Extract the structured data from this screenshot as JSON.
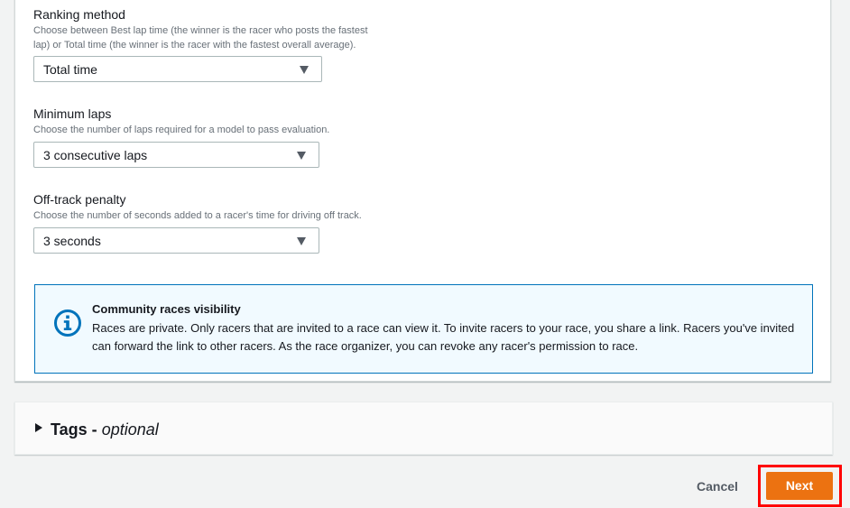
{
  "ranking": {
    "label": "Ranking method",
    "description": "Choose between Best lap time (the winner is the racer who posts the fastest lap) or Total time (the winner is the racer with the fastest overall average).",
    "desc_line1": "Choose between Best lap time (the winner is the racer who posts the fastest",
    "desc_line2": "lap) or Total time (the winner is the racer with the fastest overall average).",
    "selected": "Total time"
  },
  "min_laps": {
    "label": "Minimum laps",
    "description": "Choose the number of laps required for a model to pass evaluation.",
    "selected": "3 consecutive laps"
  },
  "penalty": {
    "label": "Off-track penalty",
    "description": "Choose the number of seconds added to a racer's time for driving off track.",
    "selected": "3 seconds"
  },
  "info": {
    "icon": "info-icon",
    "title": "Community races visibility",
    "text": "Races are private. Only racers that are invited to a race can view it. To invite racers to your race, you share a link. Racers you've invited can forward the link to other racers. As the race organizer, you can revoke any racer's permission to race."
  },
  "tags": {
    "title": "Tags -",
    "optional": "optional"
  },
  "actions": {
    "cancel": "Cancel",
    "next": "Next"
  },
  "colors": {
    "primary_button": "#ec7211",
    "info_border": "#0073bb",
    "info_background": "#f1faff",
    "highlight": "#ff0000"
  }
}
